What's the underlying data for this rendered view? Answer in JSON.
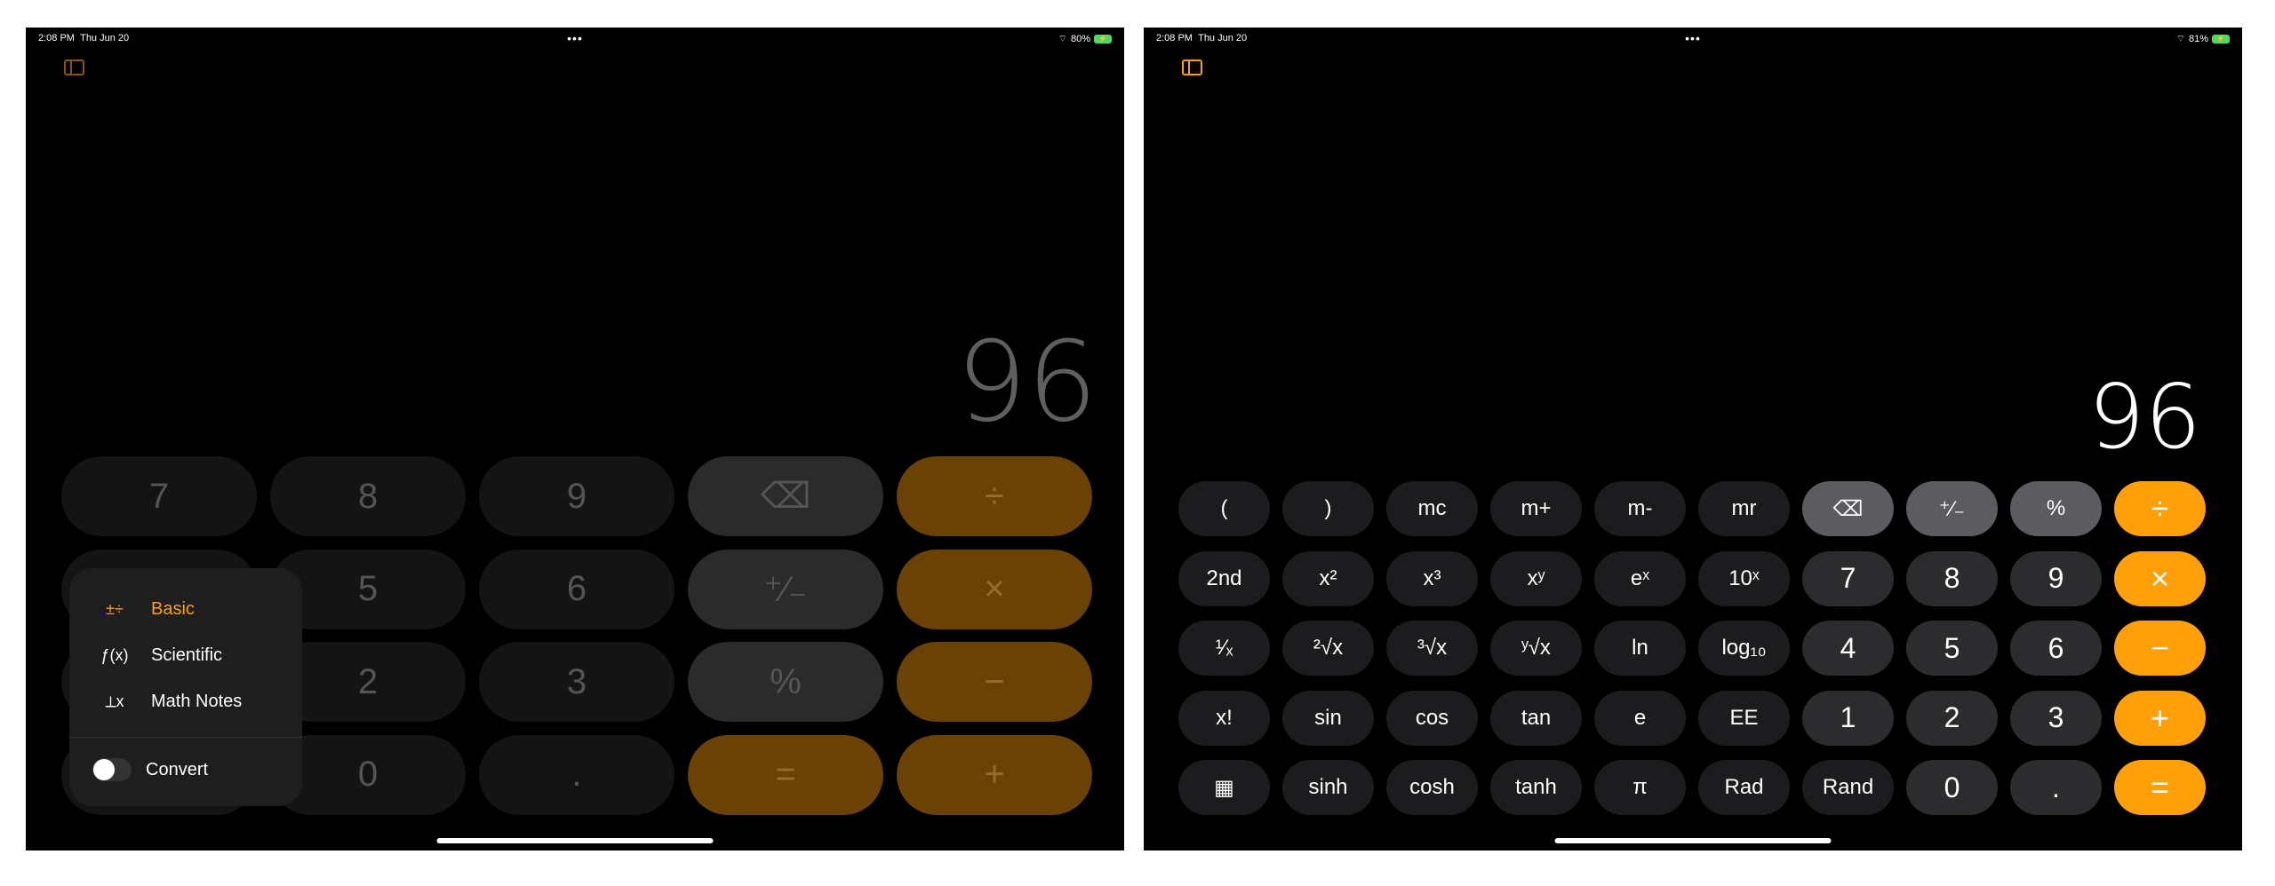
{
  "status": {
    "time": "2:08 PM",
    "date": "Thu Jun 20",
    "left_battery": "80%",
    "right_battery": "81%"
  },
  "left": {
    "display": "96",
    "keys": [
      {
        "label": "7",
        "type": "d"
      },
      {
        "label": "8",
        "type": "d"
      },
      {
        "label": "9",
        "type": "d"
      },
      {
        "label": "⌫",
        "type": "f",
        "name": "backspace-button"
      },
      {
        "label": "÷",
        "type": "o",
        "name": "divide-button"
      },
      {
        "label": "",
        "type": "d"
      },
      {
        "label": "5",
        "type": "d"
      },
      {
        "label": "6",
        "type": "d"
      },
      {
        "label": "⁺∕₋",
        "type": "f",
        "name": "plus-minus-button"
      },
      {
        "label": "×",
        "type": "o",
        "name": "multiply-button"
      },
      {
        "label": "",
        "type": "d"
      },
      {
        "label": "2",
        "type": "d"
      },
      {
        "label": "3",
        "type": "d"
      },
      {
        "label": "%",
        "type": "f",
        "name": "percent-button"
      },
      {
        "label": "−",
        "type": "o",
        "name": "minus-button"
      },
      {
        "label": "",
        "type": "d"
      },
      {
        "label": "0",
        "type": "d"
      },
      {
        "label": ".",
        "type": "d"
      },
      {
        "label": "=",
        "type": "o",
        "name": "equals-button"
      },
      {
        "label": "+",
        "type": "o",
        "name": "plus-button"
      }
    ],
    "menu": {
      "items": [
        {
          "label": "Basic",
          "icon": "basic-operators-icon",
          "glyph": "±÷",
          "selected": true
        },
        {
          "label": "Scientific",
          "icon": "function-icon",
          "glyph": "ƒ(x)"
        },
        {
          "label": "Math Notes",
          "icon": "math-notes-icon",
          "glyph": "⟂x"
        }
      ],
      "convert_label": "Convert",
      "convert_on": false
    }
  },
  "right": {
    "display": "96",
    "keys": [
      [
        "(",
        "s"
      ],
      [
        ")",
        "s"
      ],
      [
        "mc",
        "s"
      ],
      [
        "m+",
        "s"
      ],
      [
        "m-",
        "s"
      ],
      [
        "mr",
        "s"
      ],
      [
        "⌫",
        "f"
      ],
      [
        "⁺∕₋",
        "f"
      ],
      [
        "%",
        "f"
      ],
      [
        "÷",
        "o"
      ],
      [
        "2nd",
        "s"
      ],
      [
        "x²",
        "s"
      ],
      [
        "x³",
        "s"
      ],
      [
        "xʸ",
        "s"
      ],
      [
        "eˣ",
        "s"
      ],
      [
        "10ˣ",
        "s"
      ],
      [
        "7",
        "d"
      ],
      [
        "8",
        "d"
      ],
      [
        "9",
        "d"
      ],
      [
        "×",
        "o"
      ],
      [
        "¹∕ₓ",
        "s"
      ],
      [
        "²√x",
        "s"
      ],
      [
        "³√x",
        "s"
      ],
      [
        "ʸ√x",
        "s"
      ],
      [
        "ln",
        "s"
      ],
      [
        "log₁₀",
        "s"
      ],
      [
        "4",
        "d"
      ],
      [
        "5",
        "d"
      ],
      [
        "6",
        "d"
      ],
      [
        "−",
        "o"
      ],
      [
        "x!",
        "s"
      ],
      [
        "sin",
        "s"
      ],
      [
        "cos",
        "s"
      ],
      [
        "tan",
        "s"
      ],
      [
        "e",
        "s"
      ],
      [
        "EE",
        "s"
      ],
      [
        "1",
        "d"
      ],
      [
        "2",
        "d"
      ],
      [
        "3",
        "d"
      ],
      [
        "+",
        "o"
      ],
      [
        "▦",
        "s"
      ],
      [
        "sinh",
        "s"
      ],
      [
        "cosh",
        "s"
      ],
      [
        "tanh",
        "s"
      ],
      [
        "π",
        "s"
      ],
      [
        "Rad",
        "s"
      ],
      [
        "Rand",
        "s"
      ],
      [
        "0",
        "d"
      ],
      [
        ".",
        "d"
      ],
      [
        "=",
        "o"
      ]
    ]
  },
  "colors": {
    "accent": "#ff9f0a",
    "digit_key": "#2c2c2e",
    "function_key": "#5c5c60"
  }
}
